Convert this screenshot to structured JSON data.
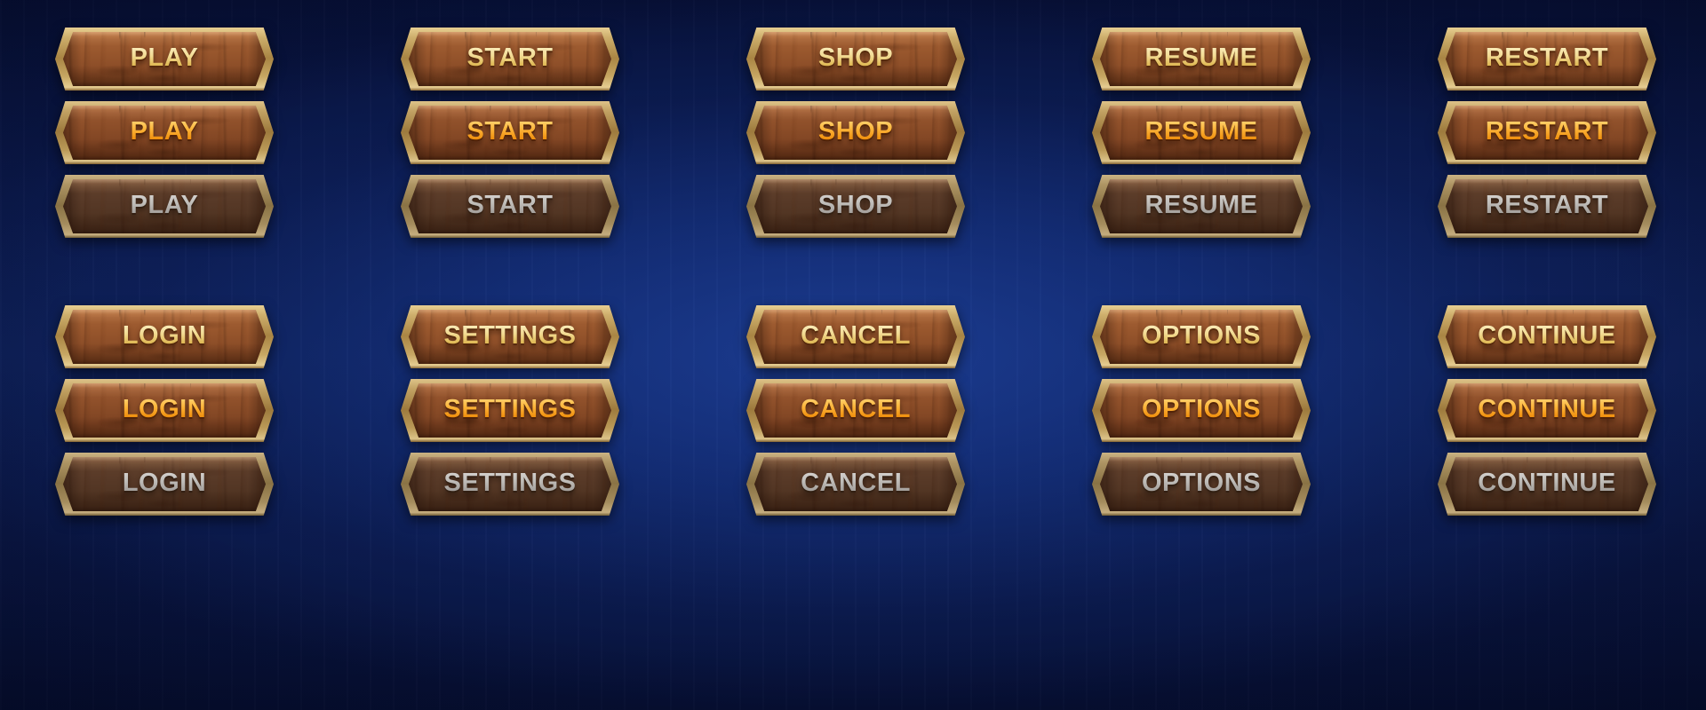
{
  "theme": {
    "background_top": "#071037",
    "background_mid": "#10245f",
    "background_bottom": "#060e30",
    "frame_gold": "#cdae6b",
    "wood_normal": "#96552c",
    "wood_hover": "#8b4d28",
    "wood_disabled": "#573927",
    "text_normal": "#f3dc95",
    "text_hover": "#fdb63c",
    "text_disabled": "#bfbcb8"
  },
  "states": [
    {
      "key": "normal",
      "name": "normal"
    },
    {
      "key": "hover",
      "name": "hover"
    },
    {
      "key": "disabled",
      "name": "disabled"
    }
  ],
  "groups": [
    {
      "name": "primary-actions",
      "columns": [
        "PLAY",
        "START",
        "SHOP",
        "RESUME",
        "RESTART"
      ],
      "rows": [
        {
          "state": "normal",
          "labels": [
            "PLAY",
            "START",
            "SHOP",
            "RESUME",
            "RESTART"
          ]
        },
        {
          "state": "hover",
          "labels": [
            "PLAY",
            "START",
            "SHOP",
            "RESUME",
            "RESTART"
          ]
        },
        {
          "state": "disabled",
          "labels": [
            "PLAY",
            "START",
            "SHOP",
            "RESUME",
            "RESTART"
          ]
        }
      ]
    },
    {
      "name": "secondary-actions",
      "columns": [
        "LOGIN",
        "SETTINGS",
        "CANCEL",
        "OPTIONS",
        "CONTINUE"
      ],
      "rows": [
        {
          "state": "normal",
          "labels": [
            "LOGIN",
            "SETTINGS",
            "CANCEL",
            "OPTIONS",
            "CONTINUE"
          ]
        },
        {
          "state": "hover",
          "labels": [
            "LOGIN",
            "SETTINGS",
            "CANCEL",
            "OPTIONS",
            "CONTINUE"
          ]
        },
        {
          "state": "disabled",
          "labels": [
            "LOGIN",
            "SETTINGS",
            "CANCEL",
            "OPTIONS",
            "CONTINUE"
          ]
        }
      ]
    }
  ]
}
